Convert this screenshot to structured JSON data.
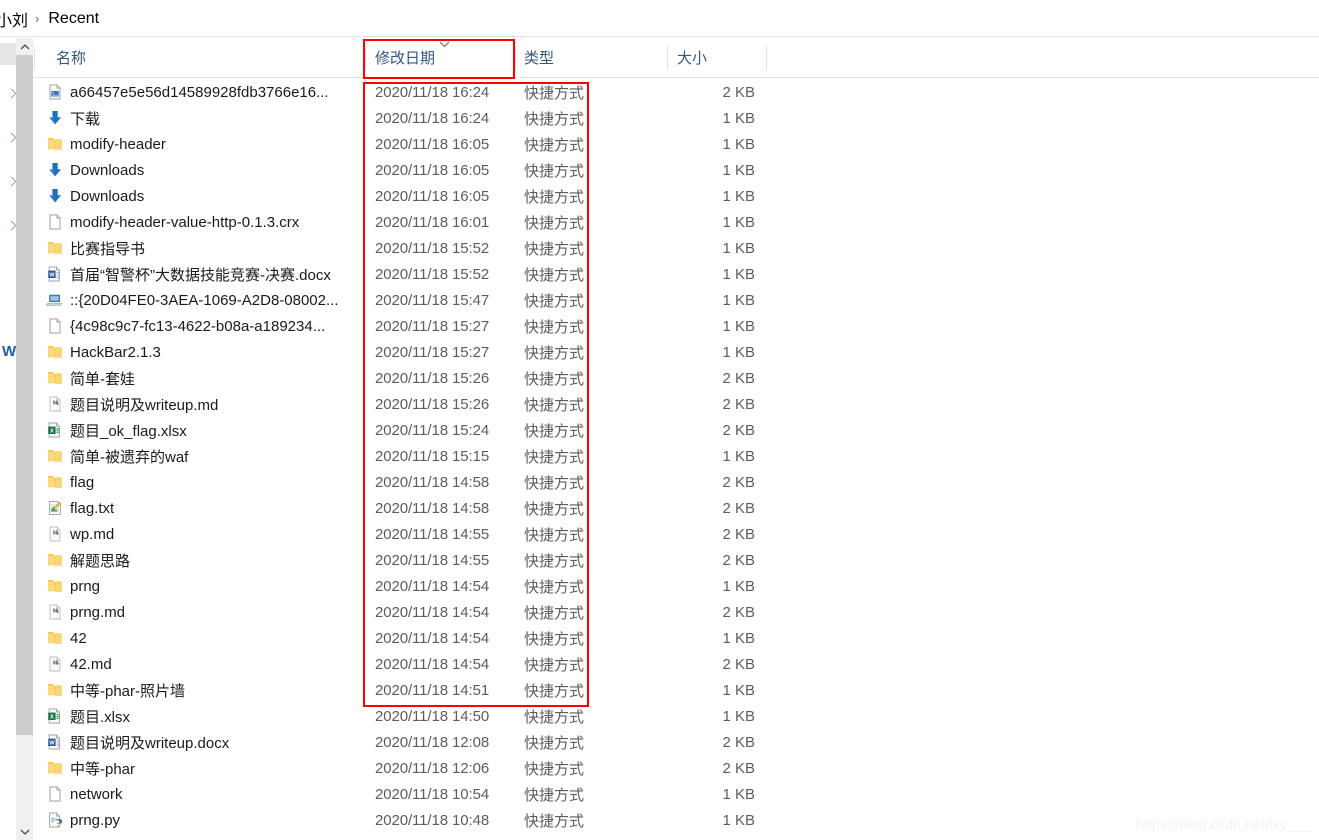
{
  "window": {
    "breadcrumb_root": "小刘",
    "breadcrumb_separator": "›",
    "breadcrumb_current": "Recent"
  },
  "columns": [
    {
      "key": "name",
      "label": "名称"
    },
    {
      "key": "date",
      "label": "修改日期"
    },
    {
      "key": "type",
      "label": "类型"
    },
    {
      "key": "size",
      "label": "大小"
    }
  ],
  "sort": {
    "column": "修改日期",
    "direction": "descending",
    "indicator_icon": "chevron-down-icon"
  },
  "annotations": {
    "header_highlight_color": "#ff0000",
    "column_highlight_color": "#ff0000",
    "header_highlight_target": "修改日期",
    "column_highlight_rows": 24
  },
  "files": [
    {
      "icon": "image-file-icon",
      "name": "a66457e5e56d14589928fdb3766e16...",
      "date": "2020/11/18 16:24",
      "type": "快捷方式",
      "size": "2 KB"
    },
    {
      "icon": "download-icon",
      "name": "下载",
      "date": "2020/11/18 16:24",
      "type": "快捷方式",
      "size": "1 KB"
    },
    {
      "icon": "folder-icon",
      "name": "modify-header",
      "date": "2020/11/18 16:05",
      "type": "快捷方式",
      "size": "1 KB"
    },
    {
      "icon": "download-icon",
      "name": "Downloads",
      "date": "2020/11/18 16:05",
      "type": "快捷方式",
      "size": "1 KB"
    },
    {
      "icon": "download-icon",
      "name": "Downloads",
      "date": "2020/11/18 16:05",
      "type": "快捷方式",
      "size": "1 KB"
    },
    {
      "icon": "generic-file-icon",
      "name": "modify-header-value-http-0.1.3.crx",
      "date": "2020/11/18 16:01",
      "type": "快捷方式",
      "size": "1 KB"
    },
    {
      "icon": "folder-icon",
      "name": "比赛指导书",
      "date": "2020/11/18 15:52",
      "type": "快捷方式",
      "size": "1 KB"
    },
    {
      "icon": "word-file-icon",
      "name": "首届“智警杯”大数据技能竞赛-决赛.docx",
      "date": "2020/11/18 15:52",
      "type": "快捷方式",
      "size": "1 KB"
    },
    {
      "icon": "computer-icon",
      "name": "::{20D04FE0-3AEA-1069-A2D8-08002...",
      "date": "2020/11/18 15:47",
      "type": "快捷方式",
      "size": "1 KB"
    },
    {
      "icon": "generic-file-icon",
      "name": "{4c98c9c7-fc13-4622-b08a-a189234...",
      "date": "2020/11/18 15:27",
      "type": "快捷方式",
      "size": "1 KB"
    },
    {
      "icon": "folder-icon",
      "name": "HackBar2.1.3",
      "date": "2020/11/18 15:27",
      "type": "快捷方式",
      "size": "1 KB"
    },
    {
      "icon": "folder-icon",
      "name": "简单-套娃",
      "date": "2020/11/18 15:26",
      "type": "快捷方式",
      "size": "2 KB"
    },
    {
      "icon": "markdown-file-icon",
      "name": "题目说明及writeup.md",
      "date": "2020/11/18 15:26",
      "type": "快捷方式",
      "size": "2 KB"
    },
    {
      "icon": "excel-file-icon",
      "name": "题目_ok_flag.xlsx",
      "date": "2020/11/18 15:24",
      "type": "快捷方式",
      "size": "2 KB"
    },
    {
      "icon": "folder-icon",
      "name": "简单-被遗弃的waf",
      "date": "2020/11/18 15:15",
      "type": "快捷方式",
      "size": "1 KB"
    },
    {
      "icon": "folder-icon",
      "name": "flag",
      "date": "2020/11/18 14:58",
      "type": "快捷方式",
      "size": "2 KB"
    },
    {
      "icon": "chart-file-icon",
      "name": "flag.txt",
      "date": "2020/11/18 14:58",
      "type": "快捷方式",
      "size": "2 KB"
    },
    {
      "icon": "markdown-file-icon",
      "name": "wp.md",
      "date": "2020/11/18 14:55",
      "type": "快捷方式",
      "size": "2 KB"
    },
    {
      "icon": "folder-icon",
      "name": "解题思路",
      "date": "2020/11/18 14:55",
      "type": "快捷方式",
      "size": "2 KB"
    },
    {
      "icon": "folder-icon",
      "name": "prng",
      "date": "2020/11/18 14:54",
      "type": "快捷方式",
      "size": "1 KB"
    },
    {
      "icon": "markdown-file-icon",
      "name": "prng.md",
      "date": "2020/11/18 14:54",
      "type": "快捷方式",
      "size": "2 KB"
    },
    {
      "icon": "folder-icon",
      "name": "42",
      "date": "2020/11/18 14:54",
      "type": "快捷方式",
      "size": "1 KB"
    },
    {
      "icon": "markdown-file-icon",
      "name": "42.md",
      "date": "2020/11/18 14:54",
      "type": "快捷方式",
      "size": "2 KB"
    },
    {
      "icon": "folder-icon",
      "name": "中等-phar-照片墙",
      "date": "2020/11/18 14:51",
      "type": "快捷方式",
      "size": "1 KB"
    },
    {
      "icon": "excel-file-icon",
      "name": "题目.xlsx",
      "date": "2020/11/18 14:50",
      "type": "快捷方式",
      "size": "1 KB"
    },
    {
      "icon": "word-file-icon",
      "name": "题目说明及writeup.docx",
      "date": "2020/11/18 12:08",
      "type": "快捷方式",
      "size": "2 KB"
    },
    {
      "icon": "folder-icon",
      "name": "中等-phar",
      "date": "2020/11/18 12:06",
      "type": "快捷方式",
      "size": "2 KB"
    },
    {
      "icon": "generic-file-icon",
      "name": "network",
      "date": "2020/11/18 10:54",
      "type": "快捷方式",
      "size": "1 KB"
    },
    {
      "icon": "python-file-icon",
      "name": "prng.py",
      "date": "2020/11/18 10:48",
      "type": "快捷方式",
      "size": "1 KB"
    }
  ],
  "watermark": "https://blog.csdn.net/lxy___"
}
